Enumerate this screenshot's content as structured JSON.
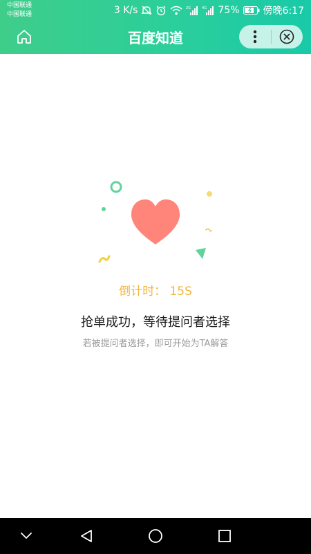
{
  "status_bar": {
    "carrier_1": "中国联通",
    "carrier_2": "中国联通",
    "net_speed": "3 K/s",
    "signal_1_label": "2G",
    "signal_2_label": "4G",
    "battery": "75%",
    "time": "傍晚6:17"
  },
  "header": {
    "title": "百度知道"
  },
  "content": {
    "countdown_label": "倒计时：",
    "countdown_value": "15S",
    "main_message": "抢单成功，等待提问者选择",
    "sub_message": "若被提问者选择，即可开始为TA解答"
  },
  "colors": {
    "header_start": "#3fcd8a",
    "header_end": "#19c9a8",
    "heart": "#ff857a",
    "countdown": "#f3b63b",
    "accent_green": "#5fd39a",
    "accent_yellow": "#f5dc6f"
  },
  "icons": {
    "home": "home-icon",
    "more": "more-vertical-icon",
    "close": "close-circle-icon",
    "nav_back": "back-triangle-icon",
    "nav_home": "home-circle-icon",
    "nav_recent": "recent-square-icon",
    "nav_down": "chevron-down-icon"
  }
}
